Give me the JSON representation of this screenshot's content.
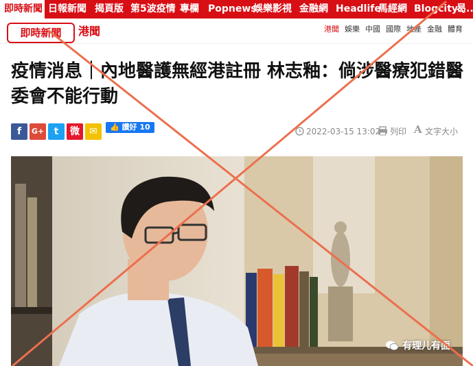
{
  "nav": {
    "items": [
      "即時新聞",
      "日報新聞",
      "揭頁版",
      "第5波疫情",
      "專欄",
      "Popnews",
      "娛樂影視",
      "金融網",
      "Headlife",
      "馬經網",
      "Blogcity",
      "曷..."
    ],
    "active": 0
  },
  "section": {
    "brand": "即時新聞",
    "title": "港聞",
    "subnav": [
      "港聞",
      "娛樂",
      "中國",
      "國際",
      "地產",
      "金融",
      "體育"
    ]
  },
  "article": {
    "headline": "疫情消息｜內地醫護無經港註冊 林志釉：倘涉醫療犯錯醫委會不能行動",
    "like_label": "讚好",
    "like_count": "10",
    "timestamp": "2022-03-15 13:02",
    "print_label": "列印",
    "font_label": "文字大小"
  },
  "share": {
    "facebook": "f",
    "google_plus": "G+",
    "twitter": "t",
    "weibo": "微",
    "email": "✉"
  },
  "watermark": "有理儿有面",
  "colors": {
    "brand_red": "#d80e15",
    "cross_orange": "#ec6f4e"
  },
  "icons": {
    "clock": "clock-icon",
    "print": "print-icon",
    "font": "font-size-icon",
    "like": "thumbs-up-icon"
  }
}
